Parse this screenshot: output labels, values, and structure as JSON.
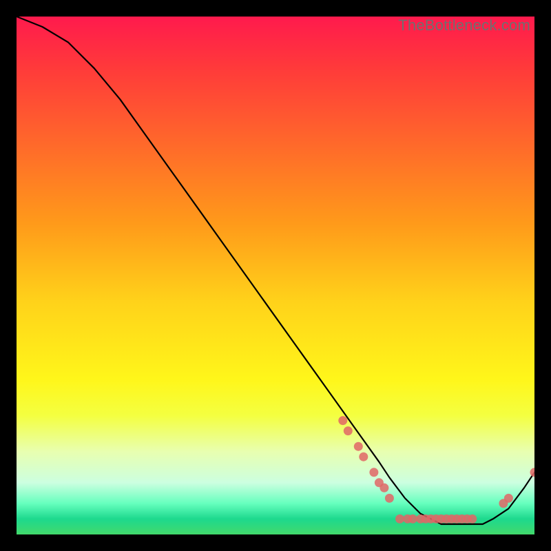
{
  "watermark": "TheBottleneck.com",
  "chart_data": {
    "type": "line",
    "title": "",
    "xlabel": "",
    "ylabel": "",
    "xlim": [
      0,
      100
    ],
    "ylim": [
      0,
      100
    ],
    "series": [
      {
        "name": "bottleneck-curve",
        "x": [
          0,
          5,
          10,
          15,
          20,
          25,
          30,
          35,
          40,
          45,
          50,
          55,
          60,
          65,
          70,
          72,
          75,
          78,
          80,
          82,
          85,
          88,
          90,
          92,
          95,
          98,
          100
        ],
        "y": [
          100,
          98,
          95,
          90,
          84,
          77,
          70,
          63,
          56,
          49,
          42,
          35,
          28,
          21,
          14,
          11,
          7,
          4,
          3,
          2,
          2,
          2,
          2,
          3,
          5,
          9,
          12
        ]
      }
    ],
    "markers": {
      "name": "highlighted-points",
      "color": "#e06666",
      "points": [
        {
          "x": 63,
          "y": 22
        },
        {
          "x": 64,
          "y": 20
        },
        {
          "x": 66,
          "y": 17
        },
        {
          "x": 67,
          "y": 15
        },
        {
          "x": 69,
          "y": 12
        },
        {
          "x": 70,
          "y": 10
        },
        {
          "x": 71,
          "y": 9
        },
        {
          "x": 72,
          "y": 7
        },
        {
          "x": 74,
          "y": 3
        },
        {
          "x": 75.5,
          "y": 3
        },
        {
          "x": 76.5,
          "y": 3
        },
        {
          "x": 78,
          "y": 3
        },
        {
          "x": 79,
          "y": 3
        },
        {
          "x": 80,
          "y": 3
        },
        {
          "x": 81,
          "y": 3
        },
        {
          "x": 82,
          "y": 3
        },
        {
          "x": 83,
          "y": 3
        },
        {
          "x": 84,
          "y": 3
        },
        {
          "x": 85,
          "y": 3
        },
        {
          "x": 86,
          "y": 3
        },
        {
          "x": 87,
          "y": 3
        },
        {
          "x": 88,
          "y": 3
        },
        {
          "x": 94,
          "y": 6
        },
        {
          "x": 95,
          "y": 7
        },
        {
          "x": 100,
          "y": 12
        }
      ]
    },
    "gradient_stops": [
      {
        "pos": 0,
        "color": "#ff1a4d"
      },
      {
        "pos": 55,
        "color": "#ffd21a"
      },
      {
        "pos": 97,
        "color": "#1dd98e"
      }
    ]
  }
}
